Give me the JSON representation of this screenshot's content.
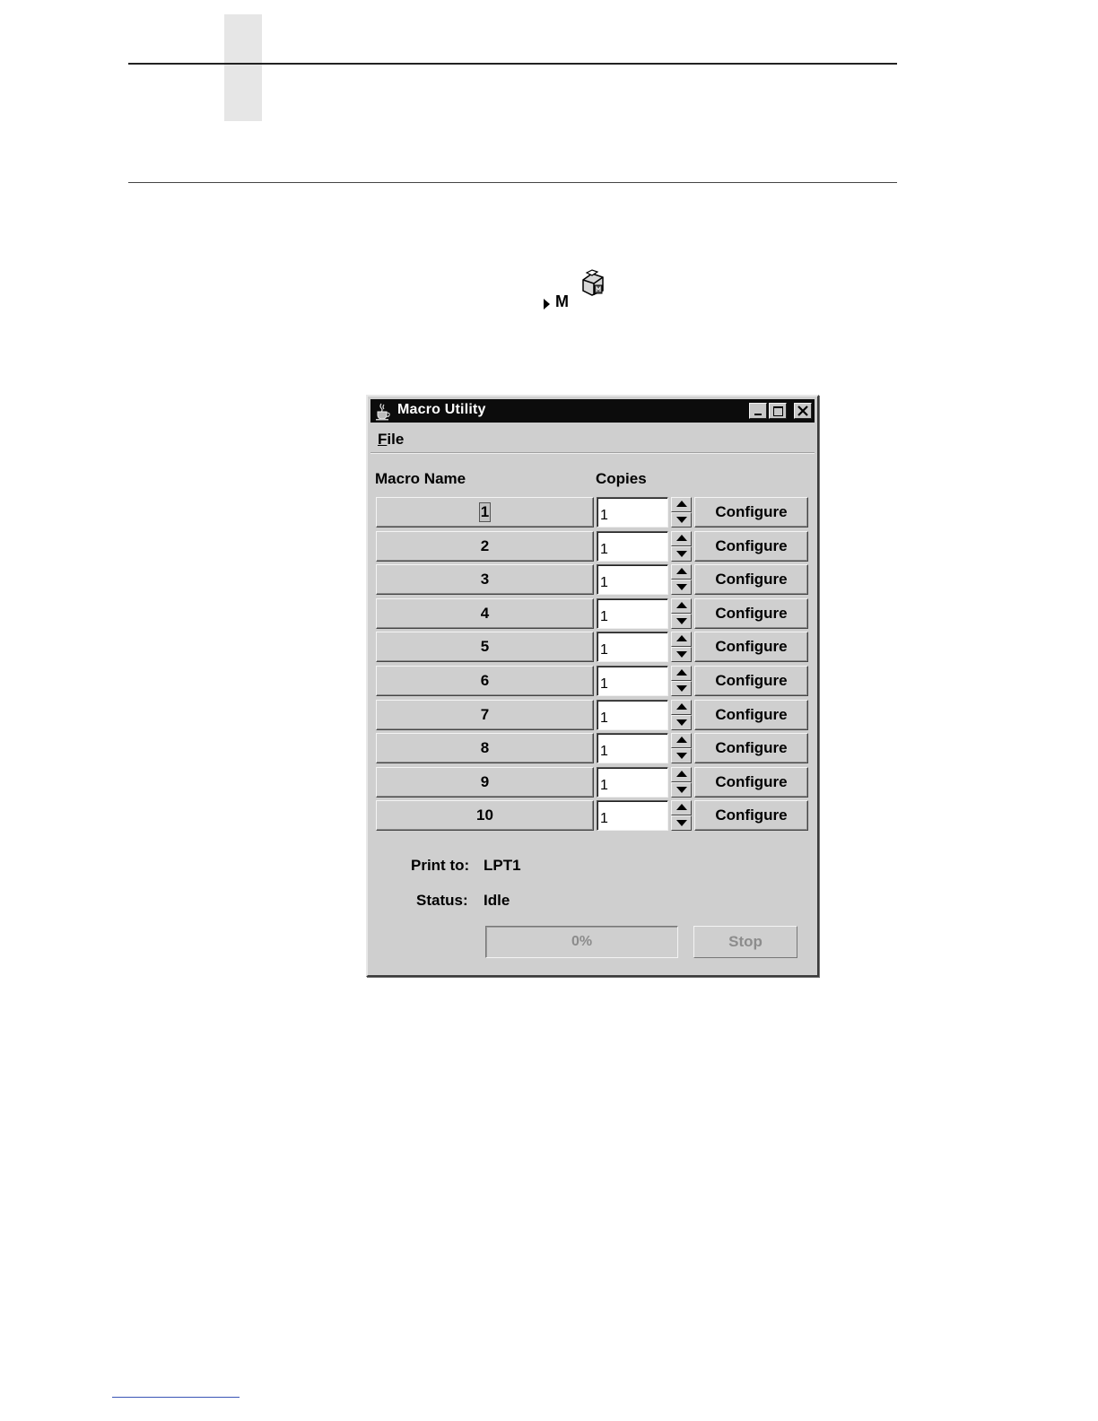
{
  "launcher": {
    "label": "M",
    "icon": "macro-printer-icon"
  },
  "window": {
    "title": "Macro Utility",
    "app_icon": "java-coffee-cup-icon",
    "controls": [
      "minimize-icon",
      "maximize-icon",
      "close-icon"
    ]
  },
  "menu": {
    "file_underlined": "F",
    "file_rest": "ile"
  },
  "headers": {
    "macro_name": "Macro Name",
    "copies": "Copies"
  },
  "macros": [
    {
      "name": "1",
      "copies": "1",
      "configure": "Configure",
      "focused": true
    },
    {
      "name": "2",
      "copies": "1",
      "configure": "Configure"
    },
    {
      "name": "3",
      "copies": "1",
      "configure": "Configure"
    },
    {
      "name": "4",
      "copies": "1",
      "configure": "Configure"
    },
    {
      "name": "5",
      "copies": "1",
      "configure": "Configure"
    },
    {
      "name": "6",
      "copies": "1",
      "configure": "Configure"
    },
    {
      "name": "7",
      "copies": "1",
      "configure": "Configure"
    },
    {
      "name": "8",
      "copies": "1",
      "configure": "Configure"
    },
    {
      "name": "9",
      "copies": "1",
      "configure": "Configure"
    },
    {
      "name": "10",
      "copies": "1",
      "configure": "Configure"
    }
  ],
  "print_to": {
    "label": "Print to:",
    "value": "LPT1"
  },
  "status": {
    "label": "Status:",
    "value": "Idle"
  },
  "progress": {
    "text": "0%",
    "fraction": 0
  },
  "stop_label": "Stop",
  "colors": {
    "titlebar": "#0c0c0c",
    "window_bg": "#cfcfcf",
    "disabled_text": "#8c8c8c"
  }
}
